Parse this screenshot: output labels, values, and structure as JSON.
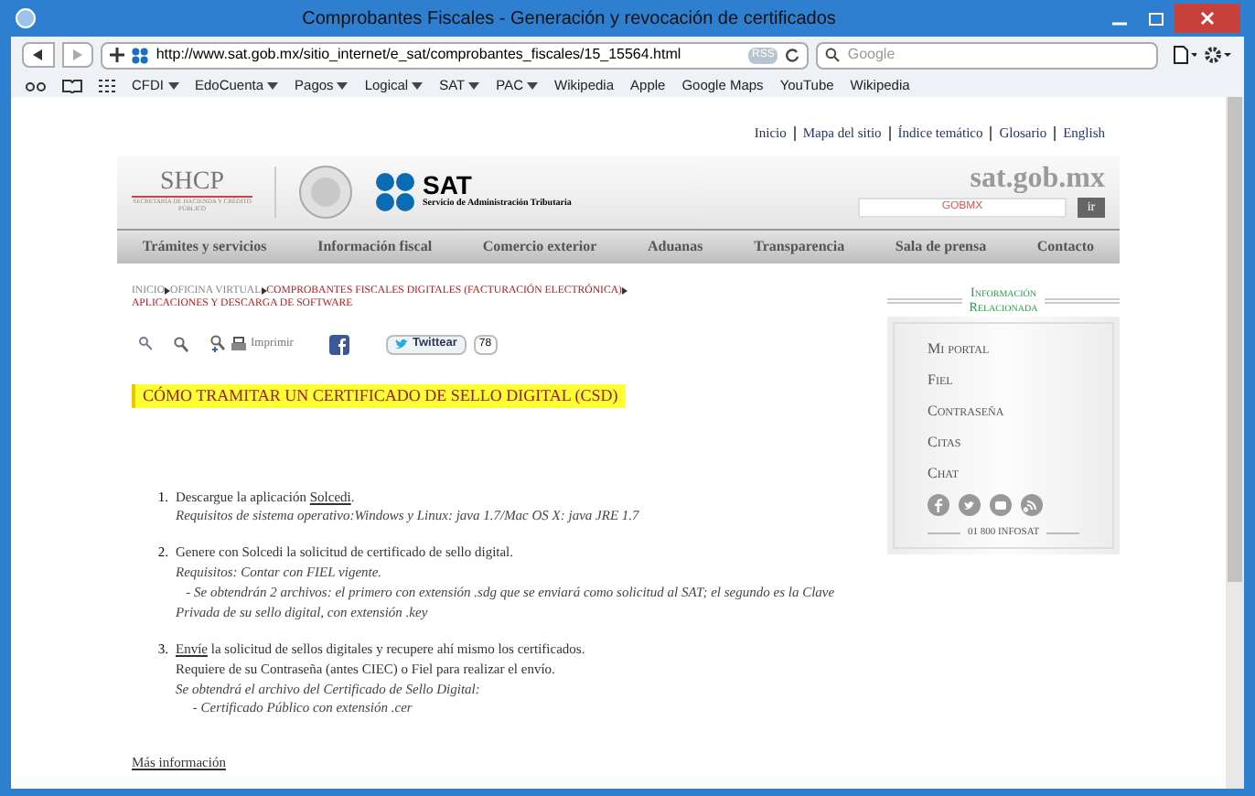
{
  "window": {
    "title": "Comprobantes Fiscales - Generación y revocación de certificados"
  },
  "address_bar": {
    "url": "http://www.sat.gob.mx/sitio_internet/e_sat/comprobantes_fiscales/15_15564.html",
    "rss": "RSS"
  },
  "search": {
    "placeholder": "Google"
  },
  "bookmarks": [
    {
      "label": "CFDI",
      "menu": true
    },
    {
      "label": "EdoCuenta",
      "menu": true
    },
    {
      "label": "Pagos",
      "menu": true
    },
    {
      "label": "Logical",
      "menu": true
    },
    {
      "label": "SAT",
      "menu": true
    },
    {
      "label": "PAC",
      "menu": true
    },
    {
      "label": "Wikipedia",
      "menu": false
    },
    {
      "label": "Apple",
      "menu": false
    },
    {
      "label": "Google Maps",
      "menu": false
    },
    {
      "label": "YouTube",
      "menu": false
    },
    {
      "label": "Wikipedia",
      "menu": false
    }
  ],
  "top_links": [
    "Inicio",
    "Mapa del sitio",
    "Índice temático",
    "Glosario",
    "English"
  ],
  "header": {
    "shcp": "SHCP",
    "shcp_sub": "SECRETARÍA DE HACIENDA Y CRÉDITO PÚBLICO",
    "sat": "SAT",
    "sat_sub": "Servicio de Administración Tributaria",
    "domain": "sat.gob.mx",
    "gob_search": "GOBMX",
    "go": "ir"
  },
  "nav": [
    "Trámites y servicios",
    "Información fiscal",
    "Comercio exterior",
    "Aduanas",
    "Transparencia",
    "Sala de prensa",
    "Contacto"
  ],
  "breadcrumb": [
    {
      "label": "INICIO",
      "color": "#888888"
    },
    {
      "label": "OFICINA VIRTUAL",
      "color": "#888888"
    },
    {
      "label": "COMPROBANTES FISCALES DIGITALES (FACTURACIÓN ELECTRÓNICA)",
      "color": "#b22222"
    },
    {
      "label": "APLICACIONES Y DESCARGA DE SOFTWARE",
      "color": "#b22222"
    }
  ],
  "tools": {
    "print": "Imprimir",
    "tweet": "Twittear",
    "tweet_count": "78"
  },
  "heading": "CÓMO TRAMITAR UN CERTIFICADO DE SELLO DIGITAL (CSD)",
  "steps": [
    {
      "number": "1.",
      "lines": [
        {
          "kind": "plain",
          "before": "Descargue la aplicación ",
          "link": "Solcedi",
          "after": "."
        },
        {
          "kind": "italic",
          "before": "Requisitos de sistema operativo:Windows y Linux: java 1.7/Mac OS X: java JRE 1.7"
        }
      ]
    },
    {
      "number": "2.",
      "lines": [
        {
          "kind": "plain",
          "before": "Genere con Solcedi la solicitud de certificado de sello digital."
        },
        {
          "kind": "italic",
          "before": "Requisitos: Contar con FIEL vigente."
        },
        {
          "kind": "italic",
          "before": "   - Se obtendrán 2 archivos: el primero con extensión .sdg que se enviará como solicitud al SAT; el segundo es la Clave Privada de su sello digital, con extensión .key"
        }
      ]
    },
    {
      "number": "3.",
      "lines": [
        {
          "kind": "plain",
          "link": "Envíe",
          "after": " la solicitud de sellos digitales y recupere ahí mismo los certificados."
        },
        {
          "kind": "plain",
          "before": "Requiere de su Contraseña (antes CIEC) o Fiel para realizar el envío."
        },
        {
          "kind": "italic",
          "before": "Se obtendrá el archivo del Certificado de Sello Digital:"
        },
        {
          "kind": "italic",
          "before": "     - Certificado Público con extensión .cer"
        }
      ]
    }
  ],
  "more_link": "Más información",
  "sidebar": {
    "title": [
      "Información",
      "Relacionada"
    ],
    "items": [
      "Mi portal",
      "Fiel",
      "Contraseña",
      "Citas",
      "Chat"
    ],
    "phone": "01 800 INFOSAT"
  }
}
